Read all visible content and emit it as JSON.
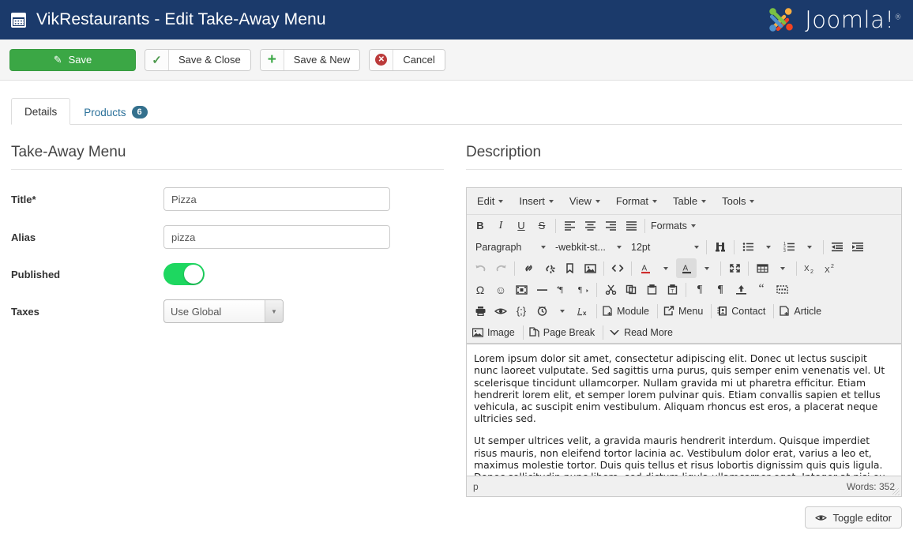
{
  "header": {
    "icon": "calendar-icon",
    "title": "VikRestaurants - Edit Take-Away Menu",
    "brand": "Joomla!",
    "brand_mark": "®",
    "bg_color": "#1b3a6b"
  },
  "toolbar": {
    "save": {
      "label": "Save",
      "icon": "pencil-square-icon",
      "color": "#3ba745"
    },
    "save_close": {
      "label": "Save & Close",
      "icon": "check-icon"
    },
    "save_new": {
      "label": "Save & New",
      "icon": "plus-icon"
    },
    "cancel": {
      "label": "Cancel",
      "icon": "circle-x-icon"
    }
  },
  "tabs": [
    {
      "label": "Details",
      "active": true,
      "badge": null
    },
    {
      "label": "Products",
      "active": false,
      "badge": "6"
    }
  ],
  "left_panel": {
    "heading": "Take-Away Menu",
    "fields": [
      {
        "label": "Title*",
        "type": "text",
        "value": "Pizza"
      },
      {
        "label": "Alias",
        "type": "text",
        "value": "pizza"
      },
      {
        "label": "Published",
        "type": "toggle",
        "value": "on"
      },
      {
        "label": "Taxes",
        "type": "select",
        "value": "Use Global"
      }
    ]
  },
  "right_panel": {
    "heading": "Description",
    "editor": {
      "menubar": [
        "Edit",
        "Insert",
        "View",
        "Format",
        "Table",
        "Tools"
      ],
      "row1": {
        "bold": "B",
        "italic": "I",
        "underline": "U",
        "strikethrough": "S",
        "align_left": "align-left-icon",
        "align_center": "align-center-icon",
        "align_right": "align-right-icon",
        "align_justify": "align-justify-icon",
        "formats": "Formats"
      },
      "row2": {
        "block": "Paragraph",
        "font": "-webkit-st...",
        "size": "12pt",
        "searchreplace": "search-replace-icon",
        "bullist": "bullet-list-icon",
        "numlist": "numbered-list-icon",
        "outdent": "outdent-icon",
        "indent": "indent-icon"
      },
      "row3": [
        "undo-icon",
        "redo-icon",
        "link-icon",
        "unlink-icon",
        "anchor-icon",
        "image-icon",
        "source-code-icon",
        "text-color-icon",
        "background-color-icon",
        "fullscreen-icon",
        "table-icon",
        "subscript-icon",
        "superscript-icon"
      ],
      "row4": [
        "special-character-icon",
        "emoticons-icon",
        "media-icon",
        "horizontal-rule-icon",
        "ltr-icon",
        "rtl-icon",
        "cut-icon",
        "copy-icon",
        "paste-icon",
        "paste-as-text-icon",
        "pilcrow-icon",
        "pilcrow-bold-icon",
        "template-icon",
        "blockquote-icon",
        "nonbreaking-icon"
      ],
      "row5": {
        "icons": [
          "print-icon",
          "preview-icon",
          "code-sample-icon",
          "insert-date-icon",
          "remove-format-icon"
        ],
        "buttons": [
          {
            "label": "Module",
            "icon": "module-icon"
          },
          {
            "label": "Menu",
            "icon": "menu-icon"
          },
          {
            "label": "Contact",
            "icon": "contact-icon"
          },
          {
            "label": "Article",
            "icon": "article-icon"
          }
        ]
      },
      "row6": [
        {
          "label": "Image",
          "icon": "image-icon"
        },
        {
          "label": "Page Break",
          "icon": "page-break-icon"
        },
        {
          "label": "Read More",
          "icon": "read-more-icon"
        }
      ],
      "content": {
        "paragraph1": "Lorem ipsum dolor sit amet, consectetur adipiscing elit. Donec ut lectus suscipit nunc laoreet vulputate. Sed sagittis urna purus, quis semper enim venenatis vel. Ut scelerisque tincidunt ullamcorper. Nullam gravida mi ut pharetra efficitur. Etiam hendrerit lorem elit, et semper lorem pulvinar quis. Etiam convallis sapien et tellus vehicula, ac suscipit enim vestibulum. Aliquam rhoncus est eros, a placerat neque ultricies sed.",
        "paragraph2": "Ut semper ultrices velit, a gravida mauris hendrerit interdum. Quisque imperdiet risus mauris, non eleifend tortor lacinia ac. Vestibulum dolor erat, varius a leo et, maximus molestie tortor. Duis quis tellus et risus lobortis dignissim quis quis ligula. Donec sollicitudin nunc libero, sed dictum ligula ullamcorper eget. Integer at nisi eu mauris viverra congue. Nulla mollis maximus condimentum. Ut pharetra tincidunt tempor. Vestibulum in tellus nec quam mattis facilisis. Proin et tincidunt lectus."
      },
      "status": {
        "path": "p",
        "words": "Words: 352"
      }
    },
    "toggle_editor": {
      "label": "Toggle editor",
      "icon": "eye-icon"
    }
  }
}
